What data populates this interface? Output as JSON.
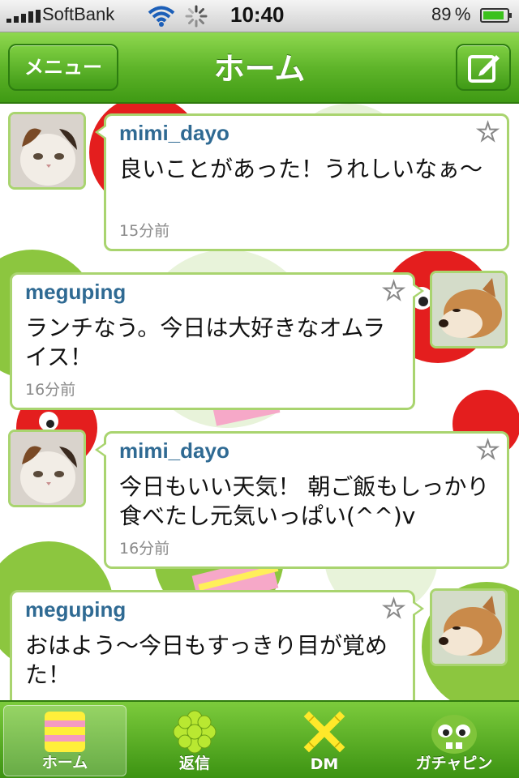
{
  "status_bar": {
    "carrier": "SoftBank",
    "time": "10:40",
    "battery_percent": "89 %",
    "battery_level": 0.89,
    "icons": [
      "signal-icon",
      "wifi-icon",
      "activity-spinner-icon",
      "battery-icon"
    ]
  },
  "nav": {
    "menu_label": "メニュー",
    "title": "ホーム",
    "compose_icon": "compose-icon"
  },
  "timeline": {
    "posts": [
      {
        "user": "mimi_dayo",
        "text": "良いことがあった！うれしいなぁ〜",
        "time": "15分前",
        "avatar": "cat",
        "side": "left"
      },
      {
        "user": "meguping",
        "text": "ランチなう。今日は大好きなオムライス！",
        "time": "16分前",
        "avatar": "dog",
        "side": "right"
      },
      {
        "user": "mimi_dayo",
        "text": "今日もいい天気！ 朝ご飯もしっかり食べたし元気いっぱい(^^)v",
        "time": "16分前",
        "avatar": "cat",
        "side": "left"
      },
      {
        "user": "meguping",
        "text": "おはよう〜今日もすっきり目が覚めた！",
        "time": "",
        "avatar": "dog",
        "side": "right"
      }
    ]
  },
  "tabs": [
    {
      "label": "ホーム",
      "icon": "home-stripes-icon",
      "active": true
    },
    {
      "label": "返信",
      "icon": "flower-reply-icon",
      "active": false
    },
    {
      "label": "DM",
      "icon": "cross-dm-icon",
      "active": false
    },
    {
      "label": "ガチャピン",
      "icon": "gachapin-face-icon",
      "active": false
    }
  ],
  "colors": {
    "accent_green": "#5fb52a",
    "bubble_border": "#a9d46f",
    "username_blue": "#2f6a93",
    "timestamp_gray": "#8a8a8a"
  }
}
